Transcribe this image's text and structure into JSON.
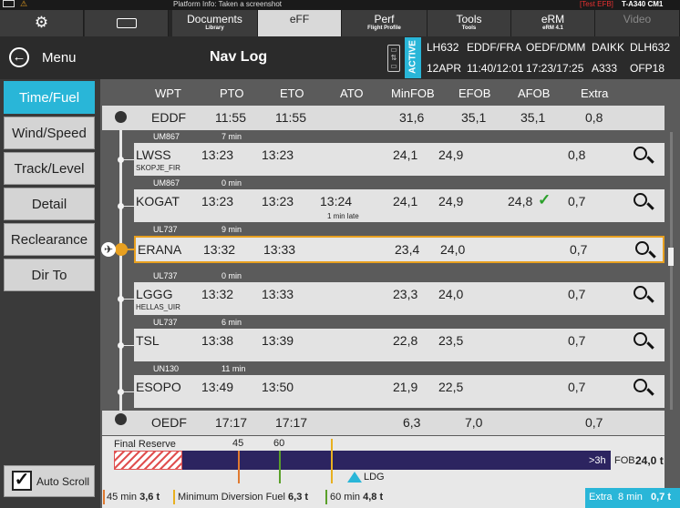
{
  "status": {
    "info": "Platform Info: Taken a screenshot",
    "test_efb": "[Test EFB]",
    "aircraft": "T-A340 CM1"
  },
  "tabs": [
    {
      "label": "Documents",
      "sub": "Library"
    },
    {
      "label": "eFF",
      "sub": ""
    },
    {
      "label": "Perf",
      "sub": "Flight Profile"
    },
    {
      "label": "Tools",
      "sub": "Tools"
    },
    {
      "label": "eRM",
      "sub": "eRM 4.1"
    },
    {
      "label": "Video",
      "sub": ""
    }
  ],
  "header": {
    "menu": "Menu",
    "title": "Nav Log",
    "active_badge": "ACTIVE",
    "flight_info_top": [
      "LH632",
      "EDDF/FRA",
      "OEDF/DMM",
      "DAIKK",
      "DLH632"
    ],
    "flight_info_bottom": [
      "12APR",
      "11:40/12:01",
      "17:23/17:25",
      "A333",
      "OFP18"
    ]
  },
  "nav": [
    "Time/Fuel",
    "Wind/Speed",
    "Track/Level",
    "Detail",
    "Reclearance",
    "Dir To"
  ],
  "auto_scroll": "Auto Scroll",
  "columns": [
    "WPT",
    "PTO",
    "ETO",
    "ATO",
    "MinFOB",
    "EFOB",
    "AFOB",
    "Extra"
  ],
  "origin": {
    "wpt": "EDDF",
    "pto": "11:55",
    "eto": "11:55",
    "ato": "",
    "minfob": "31,6",
    "efob": "35,1",
    "afob": "35,1",
    "extra": "0,8"
  },
  "legs": [
    {
      "airway": "UM867",
      "duration": "7 min",
      "wpt": "LWSS",
      "fir": "SKOPJE_FIR",
      "pto": "13:23",
      "eto": "13:23",
      "ato": "",
      "note": "",
      "minfob": "24,1",
      "efob": "24,9",
      "afob": "",
      "extra": "0,8"
    },
    {
      "airway": "UM867",
      "duration": "0 min",
      "wpt": "KOGAT",
      "fir": "",
      "pto": "13:23",
      "eto": "13:23",
      "ato": "13:24",
      "note": "1 min late",
      "minfob": "24,1",
      "efob": "24,9",
      "afob": "24,8",
      "extra": "0,7"
    },
    {
      "airway": "UL737",
      "duration": "9 min",
      "wpt": "ERANA",
      "fir": "",
      "pto": "13:32",
      "eto": "13:33",
      "ato": "",
      "note": "",
      "minfob": "23,4",
      "efob": "24,0",
      "afob": "",
      "extra": "0,7"
    },
    {
      "airway": "UL737",
      "duration": "0 min",
      "wpt": "LGGG",
      "fir": "HELLAS_UIR",
      "pto": "13:32",
      "eto": "13:33",
      "ato": "",
      "note": "",
      "minfob": "23,3",
      "efob": "24,0",
      "afob": "",
      "extra": "0,7"
    },
    {
      "airway": "UL737",
      "duration": "6 min",
      "wpt": "TSL",
      "fir": "",
      "pto": "13:38",
      "eto": "13:39",
      "ato": "",
      "note": "",
      "minfob": "22,8",
      "efob": "23,5",
      "afob": "",
      "extra": "0,7"
    },
    {
      "airway": "UN130",
      "duration": "11 min",
      "wpt": "ESOPO",
      "fir": "",
      "pto": "13:49",
      "eto": "13:50",
      "ato": "",
      "note": "",
      "minfob": "21,9",
      "efob": "22,5",
      "afob": "",
      "extra": "0,7"
    }
  ],
  "destination": {
    "wpt": "OEDF",
    "pto": "17:17",
    "eto": "17:17",
    "ato": "",
    "minfob": "6,3",
    "efob": "7,0",
    "afob": "",
    "extra": "0,7"
  },
  "fuel_bar": {
    "final_reserve": "Final Reserve",
    "mark45": "45",
    "mark60": "60",
    "over3h": ">3h",
    "fob_label": "FOB",
    "fob_value": "24,0 t",
    "ldg": "LDG"
  },
  "legend": {
    "l45": "45 min",
    "v45": "3,6 t",
    "lmdf": "Minimum Diversion Fuel",
    "vmdf": "6,3 t",
    "l60": "60 min",
    "v60": "4,8 t",
    "extra_label": "Extra",
    "extra_time": "8 min",
    "extra_val": "0,7 t"
  },
  "colors": {
    "accent": "#29b6d8",
    "current": "#e8a020",
    "fuelbar": "#2c2460",
    "check": "#2aa02a",
    "m45": "#e07a30",
    "m60": "#5aa02a",
    "mdf": "#e8b020"
  }
}
